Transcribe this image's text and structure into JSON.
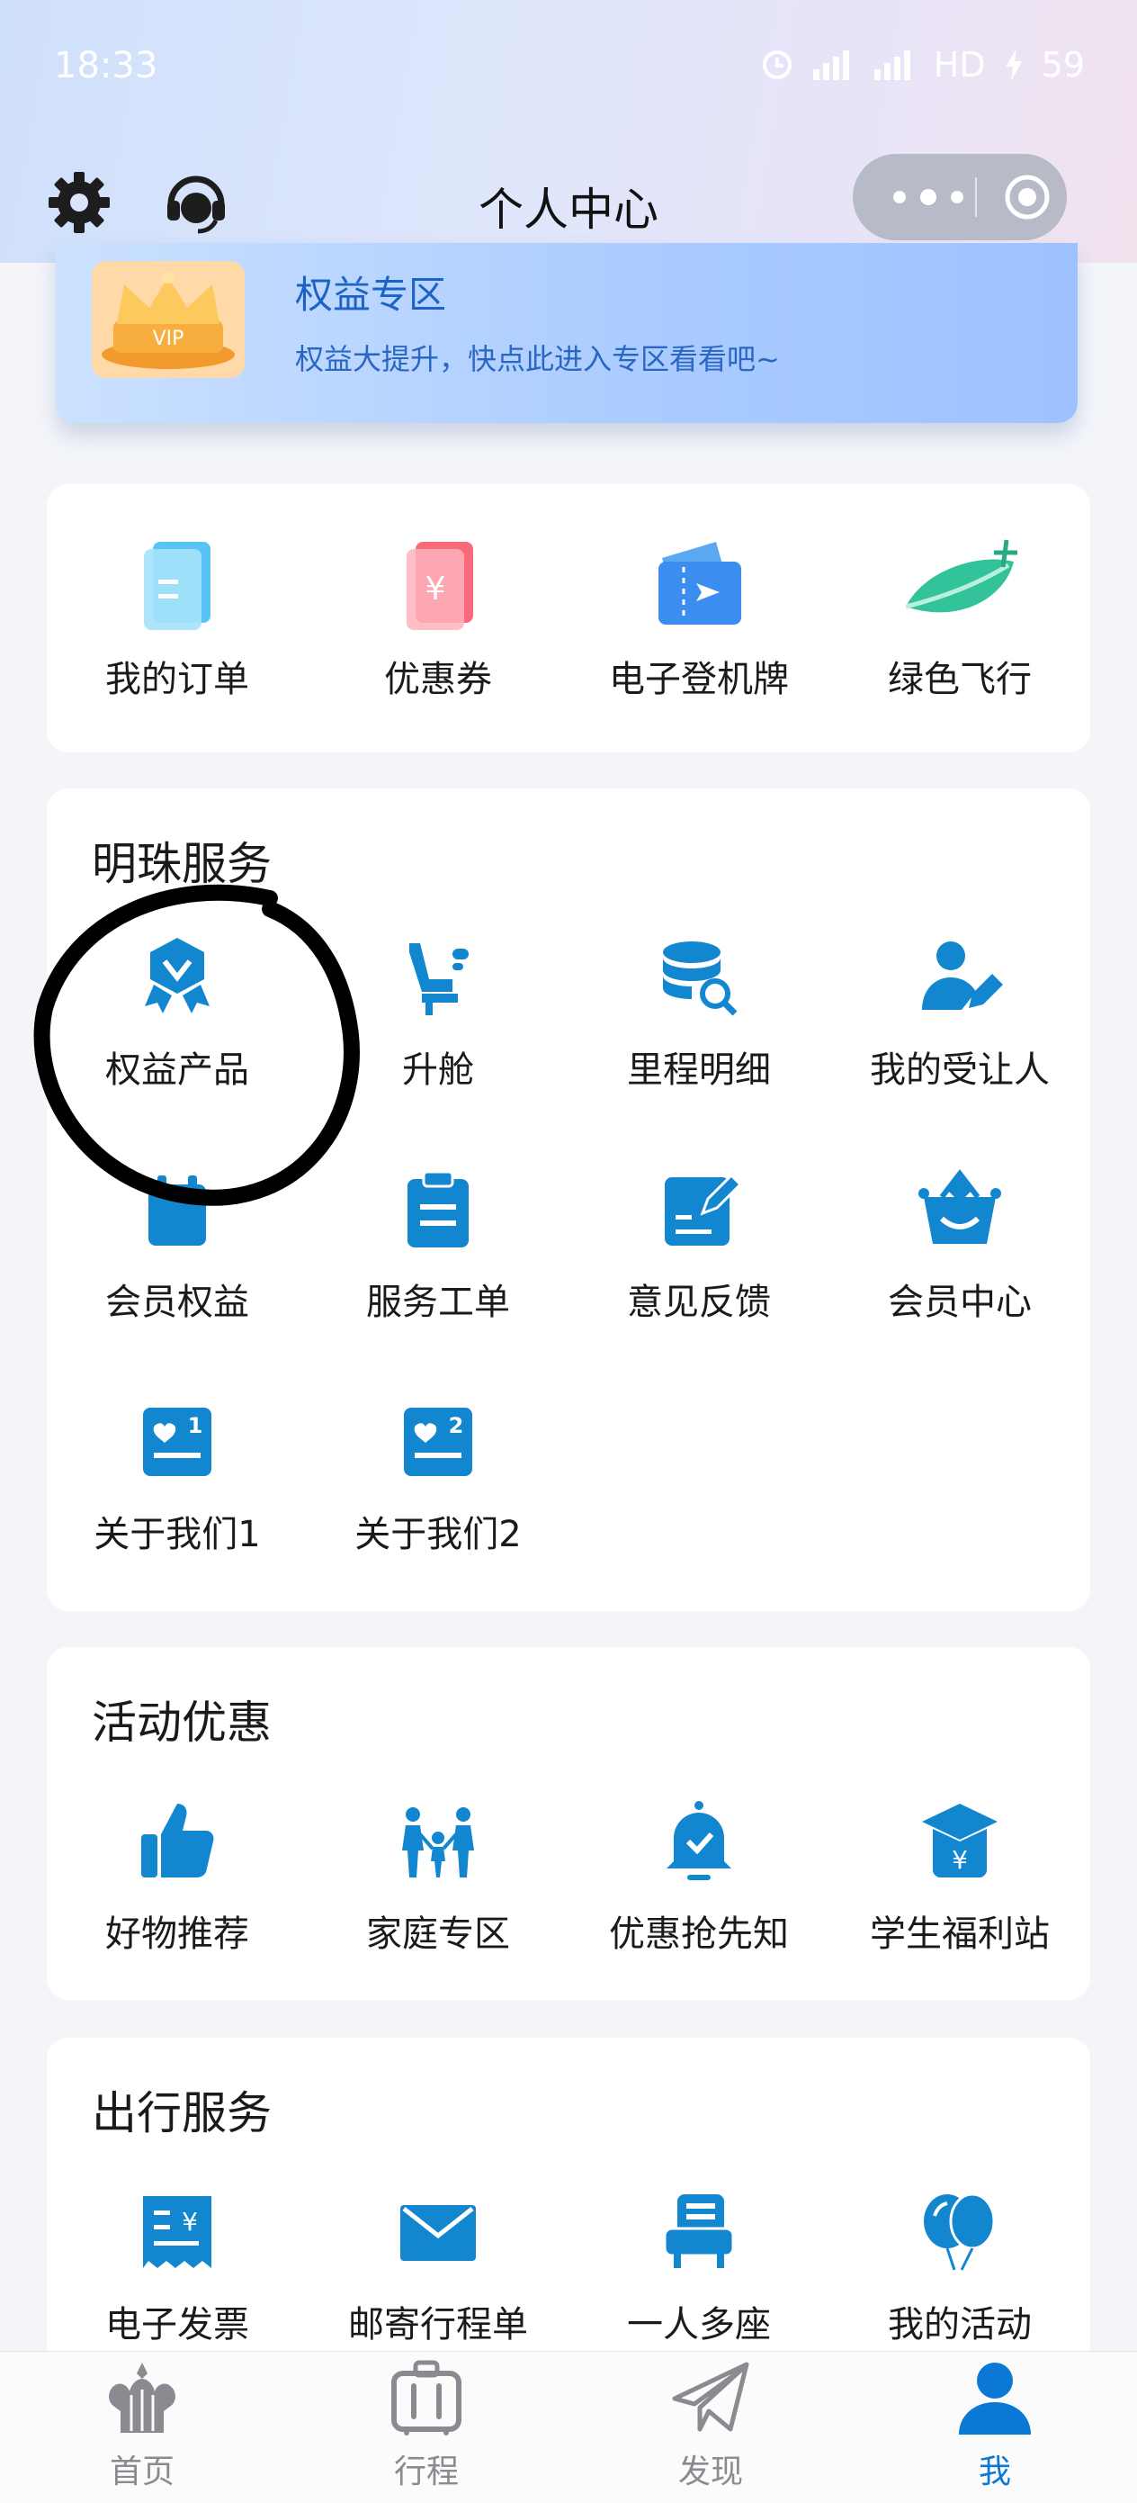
{
  "status": {
    "time": "18:33",
    "network": "HD",
    "battery": "59"
  },
  "nav": {
    "title": "个人中心"
  },
  "banner": {
    "title": "权益专区",
    "subtitle": "权益大提升，快点此进入专区看看吧~",
    "badge": "VIP"
  },
  "quick": [
    {
      "label": "我的订单",
      "icon": "order-icon"
    },
    {
      "label": "优惠券",
      "icon": "coupon-icon",
      "glyph": "¥"
    },
    {
      "label": "电子登机牌",
      "icon": "boarding-pass-icon"
    },
    {
      "label": "绿色飞行",
      "icon": "green-flight-icon"
    }
  ],
  "pearl": {
    "title": "明珠服务",
    "items": [
      {
        "label": "权益产品",
        "icon": "rights-badge-icon"
      },
      {
        "label": "升舱",
        "icon": "seat-upgrade-icon"
      },
      {
        "label": "里程明细",
        "icon": "mileage-icon"
      },
      {
        "label": "我的受让人",
        "icon": "assignee-icon"
      },
      {
        "label": "会员权益",
        "icon": "member-rights-icon"
      },
      {
        "label": "服务工单",
        "icon": "clipboard-icon"
      },
      {
        "label": "意见反馈",
        "icon": "feedback-icon"
      },
      {
        "label": "会员中心",
        "icon": "member-center-icon"
      },
      {
        "label": "关于我们1",
        "icon": "about-icon",
        "num": "1"
      },
      {
        "label": "关于我们2",
        "icon": "about-icon",
        "num": "2"
      }
    ]
  },
  "activity": {
    "title": "活动优惠",
    "items": [
      {
        "label": "好物推荐",
        "icon": "thumbs-up-icon"
      },
      {
        "label": "家庭专区",
        "icon": "family-icon"
      },
      {
        "label": "优惠抢先知",
        "icon": "bell-icon"
      },
      {
        "label": "学生福利站",
        "icon": "graduation-cap-icon",
        "glyph": "¥"
      }
    ]
  },
  "travel": {
    "title": "出行服务",
    "items": [
      {
        "label": "电子发票",
        "icon": "invoice-icon",
        "glyph": "¥"
      },
      {
        "label": "邮寄行程单",
        "icon": "mail-icon"
      },
      {
        "label": "一人多座",
        "icon": "multi-seat-icon"
      },
      {
        "label": "我的活动",
        "icon": "balloon-icon"
      }
    ]
  },
  "tabs": [
    {
      "label": "首页",
      "icon": "home-icon",
      "active": false
    },
    {
      "label": "行程",
      "icon": "luggage-icon",
      "active": false
    },
    {
      "label": "发现",
      "icon": "paper-plane-icon",
      "active": false
    },
    {
      "label": "我",
      "icon": "profile-icon",
      "active": true
    }
  ],
  "colors": {
    "accent": "#0a78d4",
    "inactive": "#8a8a90",
    "background": "#f3f5f9"
  }
}
